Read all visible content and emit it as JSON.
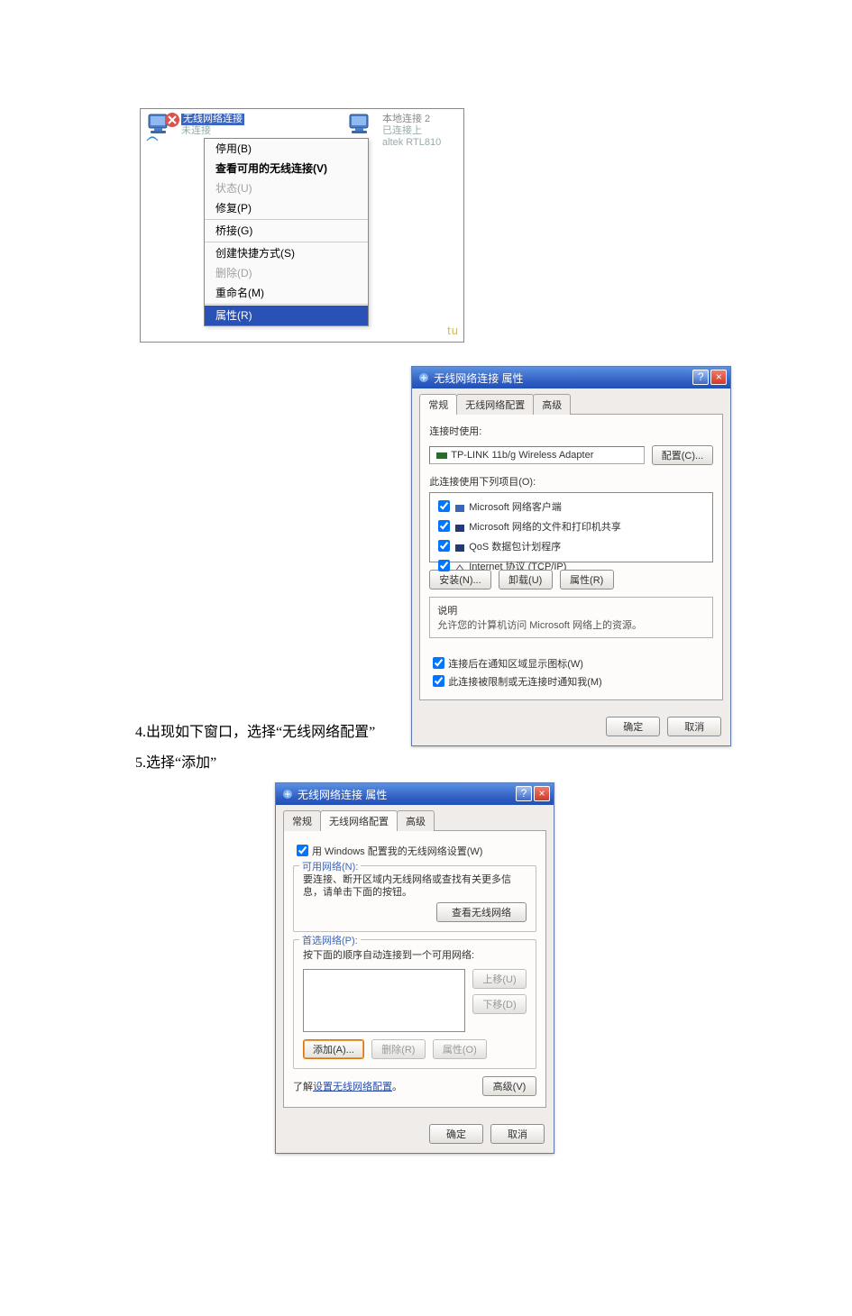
{
  "fig1": {
    "wireless": {
      "line1": "无线网络连接",
      "line2": "未连接",
      "signal_note": ""
    },
    "lan": {
      "line1": "本地连接 2",
      "line2": "已连接上",
      "line3": "altek RTL810"
    },
    "menu": {
      "disable": "停用(B)",
      "view": "查看可用的无线连接(V)",
      "status": "状态(U)",
      "repair": "修复(P)",
      "bridge": "桥接(G)",
      "shortcut": "创建快捷方式(S)",
      "delete": "删除(D)",
      "rename": "重命名(M)",
      "properties": "属性(R)"
    },
    "watermark": "tu"
  },
  "fig2": {
    "title": "无线网络连接 属性",
    "tabs": {
      "general": "常规",
      "wireless": "无线网络配置",
      "advanced": "高级"
    },
    "connect_using_label": "连接时使用:",
    "adapter_text": "TP-LINK 11b/g Wireless Adapter",
    "configure_btn": "配置(C)...",
    "items_label": "此连接使用下列项目(O):",
    "items": [
      "Microsoft 网络客户端",
      "Microsoft 网络的文件和打印机共享",
      "QoS 数据包计划程序",
      "Internet 协议 (TCP/IP)"
    ],
    "install_btn": "安装(N)...",
    "uninstall_btn": "卸载(U)",
    "props_btn": "属性(R)",
    "desc_title": "说明",
    "desc_text": "允许您的计算机访问 Microsoft 网络上的资源。",
    "show_icon": "连接后在通知区域显示图标(W)",
    "notify": "此连接被限制或无连接时通知我(M)",
    "ok": "确定",
    "cancel": "取消"
  },
  "fig3": {
    "title": "无线网络连接 属性",
    "tabs": {
      "general": "常规",
      "wireless": "无线网络配置",
      "advanced": "高级"
    },
    "use_windows": "用 Windows 配置我的无线网络设置(W)",
    "avail_title": "可用网络(N):",
    "avail_desc": "要连接、断开区域内无线网络或查找有关更多信息，请单击下面的按钮。",
    "view_btn": "查看无线网络",
    "pref_title": "首选网络(P):",
    "pref_desc": "按下面的顺序自动连接到一个可用网络:",
    "up_btn": "上移(U)",
    "down_btn": "下移(D)",
    "add_btn": "添加(A)...",
    "del_btn": "删除(R)",
    "pr_btn": "属性(O)",
    "learn_prefix": "了解",
    "learn_link": "设置无线网络配置",
    "learn_suffix": "。",
    "adv_btn": "高级(V)",
    "ok": "确定",
    "cancel": "取消"
  },
  "captions": {
    "step4": "4.出现如下窗口，选择“无线网络配置”",
    "step5": "5.选择“添加”"
  }
}
